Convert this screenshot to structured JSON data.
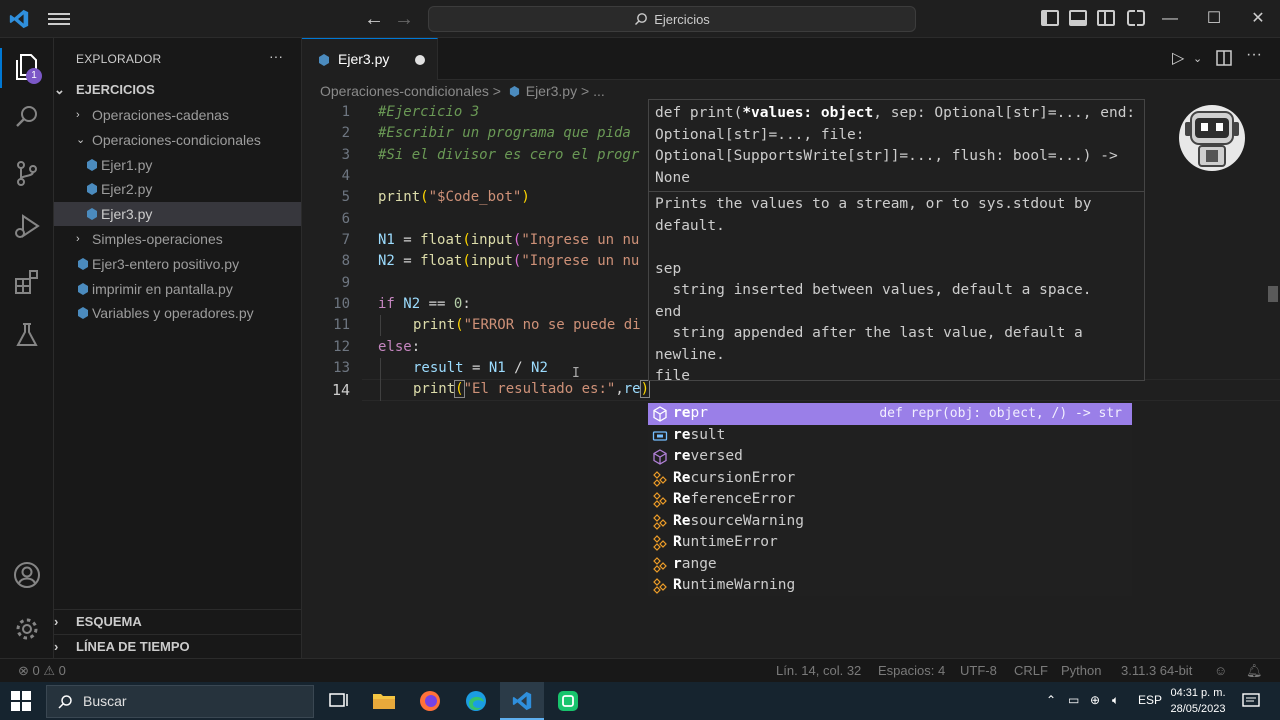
{
  "titlebar": {
    "search_text": "Ejercicios"
  },
  "activitybar": {
    "explorer_badge": "1"
  },
  "sidebar": {
    "title": "EXPLORADOR",
    "more": "···",
    "root": "EJERCICIOS",
    "items": [
      {
        "label": "Operaciones-cadenas",
        "type": "folder",
        "state": "collapsed"
      },
      {
        "label": "Operaciones-condicionales",
        "type": "folder",
        "state": "expanded"
      },
      {
        "label": "Ejer1.py",
        "type": "file"
      },
      {
        "label": "Ejer2.py",
        "type": "file"
      },
      {
        "label": "Ejer3.py",
        "type": "file",
        "selected": true
      },
      {
        "label": "Simples-operaciones",
        "type": "folder",
        "state": "collapsed"
      },
      {
        "label": "Ejer3-entero positivo.py",
        "type": "file"
      },
      {
        "label": "imprimir en pantalla.py",
        "type": "file"
      },
      {
        "label": "Variables y operadores.py",
        "type": "file"
      }
    ],
    "sections": [
      "ESQUEMA",
      "LÍNEA DE TIEMPO"
    ]
  },
  "tabs": {
    "active": "Ejer3.py"
  },
  "breadcrumb": {
    "folder": "Operaciones-condicionales",
    "sep1": ">",
    "file": "Ejer3.py",
    "sep2": ">",
    "more": "..."
  },
  "editor": {
    "line_numbers": [
      "1",
      "2",
      "3",
      "4",
      "5",
      "6",
      "7",
      "8",
      "9",
      "10",
      "11",
      "12",
      "13",
      "14"
    ],
    "active_line": "14",
    "lines": {
      "l1": "#Ejercicio 3",
      "l2": "#Escribir un programa que pida",
      "l3": "#Si el divisor es cero el progr",
      "l5_fn": "print",
      "l5_str": "\"$Code_bot\"",
      "l7_var": "N1",
      "l7_fn1": "float",
      "l7_fn2": "input",
      "l7_str": "\"Ingrese un nu",
      "l8_var": "N2",
      "l8_fn1": "float",
      "l8_fn2": "input",
      "l8_str": "\"Ingrese un nu",
      "l10_kw": "if",
      "l10_var": "N2",
      "l10_op": "==",
      "l10_num": "0",
      "l11_fn": "print",
      "l11_str": "\"ERROR no se puede di",
      "l12_kw": "else",
      "l13_var": "result",
      "l13_rhs1": "N1",
      "l13_rhs2": "N2",
      "l14_fn": "print",
      "l14_str": "\"El resultado es:\"",
      "l14_typed": "re"
    }
  },
  "signature": {
    "head_pre": "def print(",
    "head_bold": "*values: object",
    "head_post": ", sep: Optional[str]=..., end: Optional[str]=..., file: Optional[SupportsWrite[str]]=..., flush: bool=...) -> None",
    "doc": "Prints the values to a stream, or to sys.stdout by\ndefault.\n\nsep\n  string inserted between values, default a space.\nend\n  string appended after the last value, default a\nnewline.\nfile"
  },
  "suggestions": [
    {
      "bold": "re",
      "rest": "pr",
      "icon": "method-icon",
      "detail": "def repr(obj: object, /) -> str",
      "focused": true
    },
    {
      "bold": "re",
      "rest": "sult",
      "icon": "variable-icon"
    },
    {
      "bold": "re",
      "rest": "versed",
      "icon": "method-icon"
    },
    {
      "bold": "Re",
      "rest": "cursionError",
      "icon": "class-icon"
    },
    {
      "bold": "Re",
      "rest": "ferenceError",
      "icon": "class-icon"
    },
    {
      "bold": "Re",
      "rest": "sourceWarning",
      "icon": "class-icon"
    },
    {
      "bold": "R",
      "rest": "untimeError",
      "icon": "class-icon",
      "mid_bold": "e"
    },
    {
      "bold": "r",
      "rest": "ange",
      "icon": "class-icon",
      "mid_bold": "e"
    },
    {
      "bold": "R",
      "rest": "untimeWarning",
      "icon": "class-icon",
      "mid_bold": "e"
    }
  ],
  "statusbar": {
    "errors": "0",
    "warnings": "0",
    "position": "Lín. 14, col. 32",
    "spaces": "Espacios: 4",
    "encoding": "UTF-8",
    "eol": "CRLF",
    "language": "Python",
    "interpreter": "3.11.3 64-bit"
  },
  "taskbar": {
    "search": "Buscar",
    "lang": "ESP",
    "time": "04:31 p. m.",
    "date": "28/05/2023"
  },
  "colors": {
    "accent": "#0078d4",
    "suggest_focus": "#9a7fe8",
    "badge": "#7b58c7"
  }
}
